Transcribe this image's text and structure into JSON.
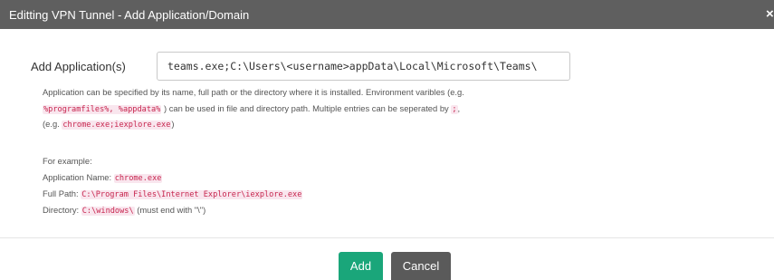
{
  "dialog": {
    "title": "Editting VPN Tunnel - Add Application/Domain",
    "close_label": "×"
  },
  "form": {
    "label": "Add Application(s)",
    "value": "teams.exe;C:\\Users\\<username>appData\\Local\\Microsoft\\Teams\\"
  },
  "help": {
    "line1": "Application can be specified by its name, full path or the directory where it is installed. Environment varibles (e.g.",
    "line2_code": "%programfiles%, %appdata%",
    "line2_text": " ) can be used in file and directory path. Multiple entries can be seperated by ",
    "line2_sep_code": ";",
    "line2_end": ",",
    "line3_prefix": "(e.g. ",
    "line3_code": "chrome.exe;iexplore.exe",
    "line3_suffix": ")",
    "example_heading": "For example:",
    "app_name_label": "Application Name: ",
    "app_name_code": "chrome.exe",
    "full_path_label": "Full Path: ",
    "full_path_code": "C:\\Program Files\\Internet Explorer\\iexplore.exe",
    "directory_label": "Directory: ",
    "directory_code": "C:\\windows\\",
    "directory_note": " (must end with \"\\\")"
  },
  "buttons": {
    "add": "Add",
    "cancel": "Cancel"
  },
  "colors": {
    "titlebar": "#5f5f5f",
    "add_button": "#1aa67a",
    "cancel_button": "#5a5a5a",
    "code_text": "#c7254e",
    "code_background": "#f9e6ee"
  }
}
